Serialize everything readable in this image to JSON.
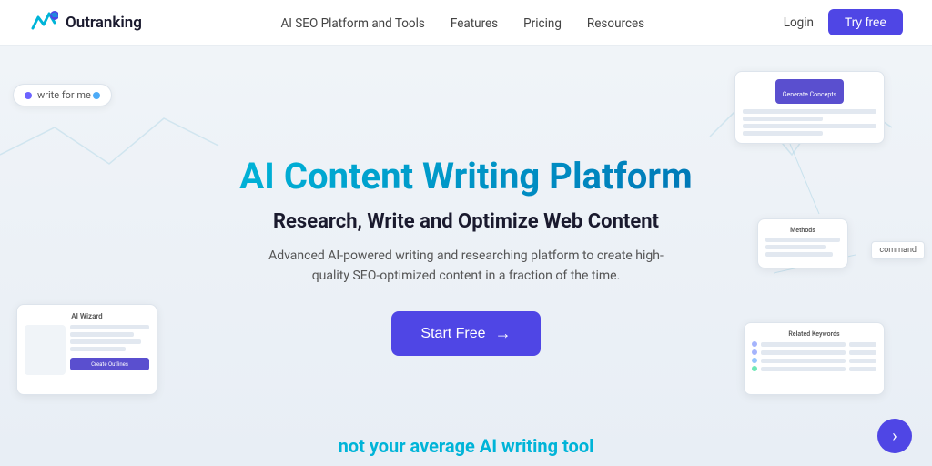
{
  "nav": {
    "logo_text": "Outranking",
    "links": [
      {
        "id": "ai-seo",
        "label": "AI SEO Platform and Tools"
      },
      {
        "id": "features",
        "label": "Features"
      },
      {
        "id": "pricing",
        "label": "Pricing"
      },
      {
        "id": "resources",
        "label": "Resources"
      }
    ],
    "login_label": "Login",
    "try_free_label": "Try free"
  },
  "hero": {
    "title": "AI Content Writing Platform",
    "subtitle": "Research, Write and Optimize Web Content",
    "description": "Advanced AI-powered writing and researching platform to create high-quality SEO-optimized content in a fraction of the time.",
    "cta_label": "Start Free",
    "cta_arrow": "→"
  },
  "decorative": {
    "write_for_me": "write for me",
    "ai_wizard_title": "AI Wizard",
    "create_outlines_btn": "Create Outlines",
    "generate_concepts_btn": "Generate Concepts",
    "methods_title": "Methods",
    "command_tag": "command",
    "related_keywords_title": "Related Keywords"
  },
  "bottom": {
    "teaser": "not your average AI writing tool"
  },
  "colors": {
    "accent_blue": "#4f46e5",
    "teal": "#00b4d8",
    "dark": "#1a1a2e"
  }
}
